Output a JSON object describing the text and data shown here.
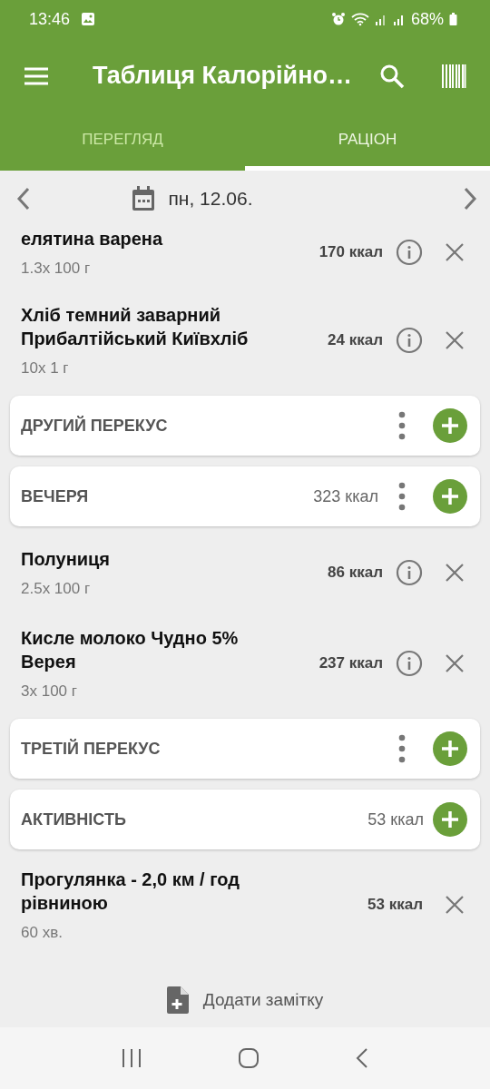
{
  "status_bar": {
    "time": "13:46",
    "battery": "68%"
  },
  "app_bar": {
    "title": "Таблиця Калорійно…"
  },
  "tabs": [
    {
      "label": "ПЕРЕГЛЯД",
      "selected": false
    },
    {
      "label": "РАЦІОН",
      "selected": true
    }
  ],
  "date": "пн, 12.06.",
  "entries": [
    {
      "kind": "food",
      "name": "елятина варена",
      "amount": "1.3x 100 г",
      "kcal": "170 ккал"
    },
    {
      "kind": "food",
      "name": "Хліб темний заварний Прибалтійський Київхліб",
      "amount": "10x 1 г",
      "kcal": "24 ккал"
    },
    {
      "kind": "meal",
      "title": "ДРУГИЙ ПЕРЕКУС"
    },
    {
      "kind": "meal",
      "title": "ВЕЧЕРЯ",
      "kcal": "323 ккал"
    },
    {
      "kind": "food",
      "name": "Полуниця",
      "amount": "2.5x 100 г",
      "kcal": "86 ккал"
    },
    {
      "kind": "food",
      "name": "Кисле молоко Чудно 5% Верея",
      "amount": "3x 100 г",
      "kcal": "237 ккал"
    },
    {
      "kind": "meal",
      "title": "ТРЕТІЙ ПЕРЕКУС"
    },
    {
      "kind": "activity_header",
      "title": "АКТИВНІСТЬ",
      "kcal": "53 ккал"
    },
    {
      "kind": "exercise",
      "name": "Прогулянка - 2,0 км / год рівниною",
      "amount": "60 хв.",
      "kcal": "53 ккал"
    }
  ],
  "add_note": "Додати замітку"
}
